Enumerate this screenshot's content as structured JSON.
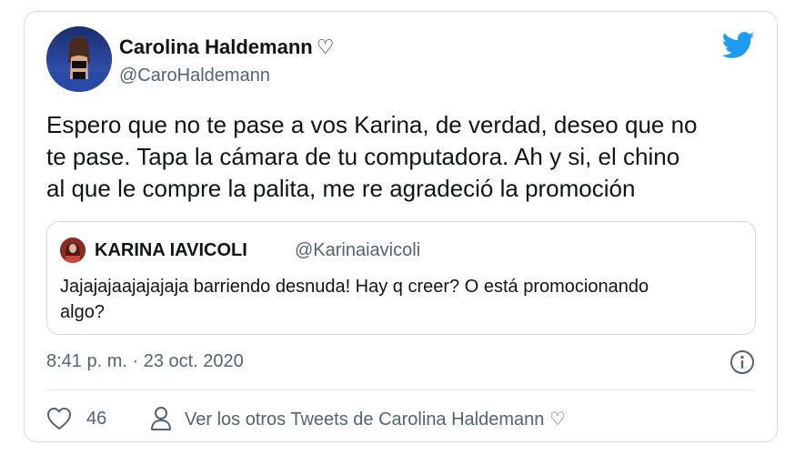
{
  "author": {
    "name": "Carolina Haldemann",
    "name_suffix": "♡",
    "handle": "@CaroHaldemann"
  },
  "tweet": {
    "lines": [
      "Espero que no te pase a vos Karina, de verdad, deseo que no",
      "te pase. Tapa la cámara de tu computadora. Ah y si, el chino",
      "al que le compre la palita, me re agradeció la promoción"
    ]
  },
  "quoted": {
    "name": "KARINA IAVICOLI",
    "handle": "@Karinaiavicoli",
    "lines": [
      "Jajajajaajajajaja barriendo desnuda! Hay q creer? O está promocionando",
      "algo?"
    ]
  },
  "timestamp": "8:41 p. m. · 23 oct. 2020",
  "actions": {
    "like_count": "46",
    "profile_link": "Ver los otros Tweets de Carolina Haldemann ♡"
  },
  "colors": {
    "twitter_blue": "#1d9bf0",
    "text_primary": "#0f1419",
    "text_secondary": "#536471"
  },
  "icons": [
    "twitter-bird-icon",
    "info-icon",
    "heart-icon",
    "person-icon"
  ]
}
